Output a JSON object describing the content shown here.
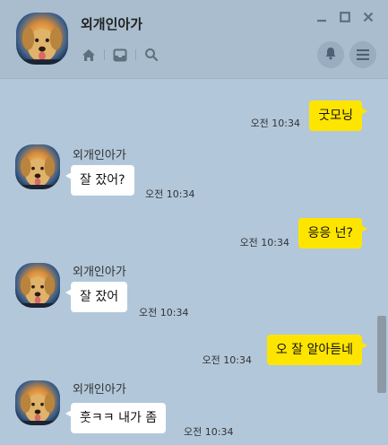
{
  "chat": {
    "title": "외개인아가"
  },
  "icons": {
    "home": "home-icon",
    "inbox": "inbox-icon",
    "search": "search-icon",
    "minimize": "minimize-icon",
    "maximize": "maximize-icon",
    "close": "close-icon",
    "bell": "bell-icon",
    "menu": "menu-icon"
  },
  "colors": {
    "background": "#b2c7da",
    "my_bubble": "#fee500",
    "other_bubble": "#ffffff"
  },
  "messages": [
    {
      "from": "me",
      "text": "굿모닝",
      "time": "오전 10:34"
    },
    {
      "from": "other",
      "sender": "외개인아가",
      "text": "잘 잤어?",
      "time": "오전 10:34"
    },
    {
      "from": "me",
      "text": "응응 넌?",
      "time": "오전 10:34"
    },
    {
      "from": "other",
      "sender": "외개인아가",
      "text": "잘 잤어",
      "time": "오전 10:34"
    },
    {
      "from": "me",
      "text": "오 잘 알아듣네",
      "time": "오전 10:34"
    },
    {
      "from": "other",
      "sender": "외개인아가",
      "text": "훗ㅋㅋ 내가 좀",
      "time": "오전 10:34"
    }
  ]
}
